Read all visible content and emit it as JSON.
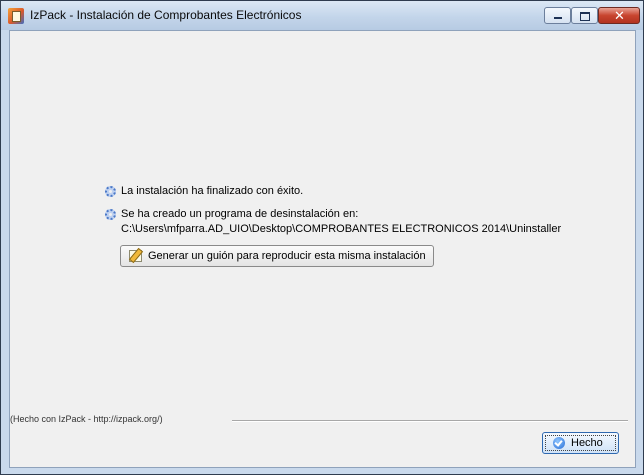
{
  "window": {
    "title": "IzPack - Instalación de Comprobantes Electrónicos",
    "icons": [
      "app-icon",
      "minimize-icon",
      "maximize-icon",
      "close-icon"
    ]
  },
  "messages": {
    "success": "La instalación ha finalizado con éxito.",
    "uninstaller_created": "Se ha creado un programa de desinstalación en:",
    "uninstaller_path": "C:\\Users\\mfparra.AD_UIO\\Desktop\\COMPROBANTES ELECTRONICOS 2014\\Uninstaller"
  },
  "actions": {
    "generate_script_label": "Generar un guión para reproducir esta misma instalación",
    "done_label": "Hecho"
  },
  "footer": {
    "credit": "(Hecho con IzPack - http://izpack.org/)"
  }
}
